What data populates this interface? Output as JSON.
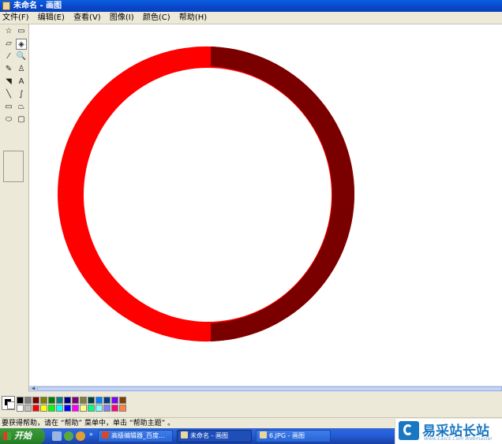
{
  "window": {
    "title": "未命名 - 画图"
  },
  "menu": [
    "文件(F)",
    "编辑(E)",
    "查看(V)",
    "图像(I)",
    "颜色(C)",
    "帮助(H)"
  ],
  "tools": [
    {
      "name": "free-select-tool",
      "icon": "☆",
      "selected": false
    },
    {
      "name": "rect-select-tool",
      "icon": "▭",
      "selected": false
    },
    {
      "name": "eraser-tool",
      "icon": "▱",
      "selected": false
    },
    {
      "name": "fill-tool",
      "icon": "◈",
      "selected": true
    },
    {
      "name": "pick-color-tool",
      "icon": "⁄",
      "selected": false
    },
    {
      "name": "magnifier-tool",
      "icon": "🔍",
      "selected": false
    },
    {
      "name": "pencil-tool",
      "icon": "✎",
      "selected": false
    },
    {
      "name": "brush-tool",
      "icon": "♙",
      "selected": false
    },
    {
      "name": "airbrush-tool",
      "icon": "◥",
      "selected": false
    },
    {
      "name": "text-tool",
      "icon": "A",
      "selected": false
    },
    {
      "name": "line-tool",
      "icon": "╲",
      "selected": false
    },
    {
      "name": "curve-tool",
      "icon": "∫",
      "selected": false
    },
    {
      "name": "rectangle-tool",
      "icon": "▭",
      "selected": false
    },
    {
      "name": "polygon-tool",
      "icon": "⏢",
      "selected": false
    },
    {
      "name": "ellipse-tool",
      "icon": "⬭",
      "selected": false
    },
    {
      "name": "rounded-rect-tool",
      "icon": "▢",
      "selected": false
    }
  ],
  "palette": {
    "foreground": "#000000",
    "background": "#ffffff",
    "row1": [
      "#000000",
      "#808080",
      "#800000",
      "#808000",
      "#008000",
      "#008080",
      "#000080",
      "#800080",
      "#808040",
      "#004040",
      "#0080ff",
      "#004080",
      "#8000ff",
      "#804000"
    ],
    "row2": [
      "#ffffff",
      "#c0c0c0",
      "#ff0000",
      "#ffff00",
      "#00ff00",
      "#00ffff",
      "#0000ff",
      "#ff00ff",
      "#ffff80",
      "#00ff80",
      "#80ffff",
      "#8080ff",
      "#ff0080",
      "#ff8040"
    ]
  },
  "canvas": {
    "ring_color": "#ff0000",
    "ring_shade_color": "#7a0000"
  },
  "status": {
    "text": "要获得帮助，请在 “帮助” 菜单中，单击 “帮助主题” 。"
  },
  "taskbar": {
    "start_label": "开始",
    "tasks": [
      {
        "label": "高级编辑器_百度...",
        "icon_color": "#d04a2a",
        "active": false
      },
      {
        "label": "未命名 - 画图",
        "icon_color": "#e8d5a0",
        "active": true
      },
      {
        "label": "6.JPG - 画图",
        "icon_color": "#e8d5a0",
        "active": false
      }
    ]
  },
  "watermark": {
    "brand": "易采站长站",
    "url": "Www.Easck.Com  Webmaster"
  }
}
